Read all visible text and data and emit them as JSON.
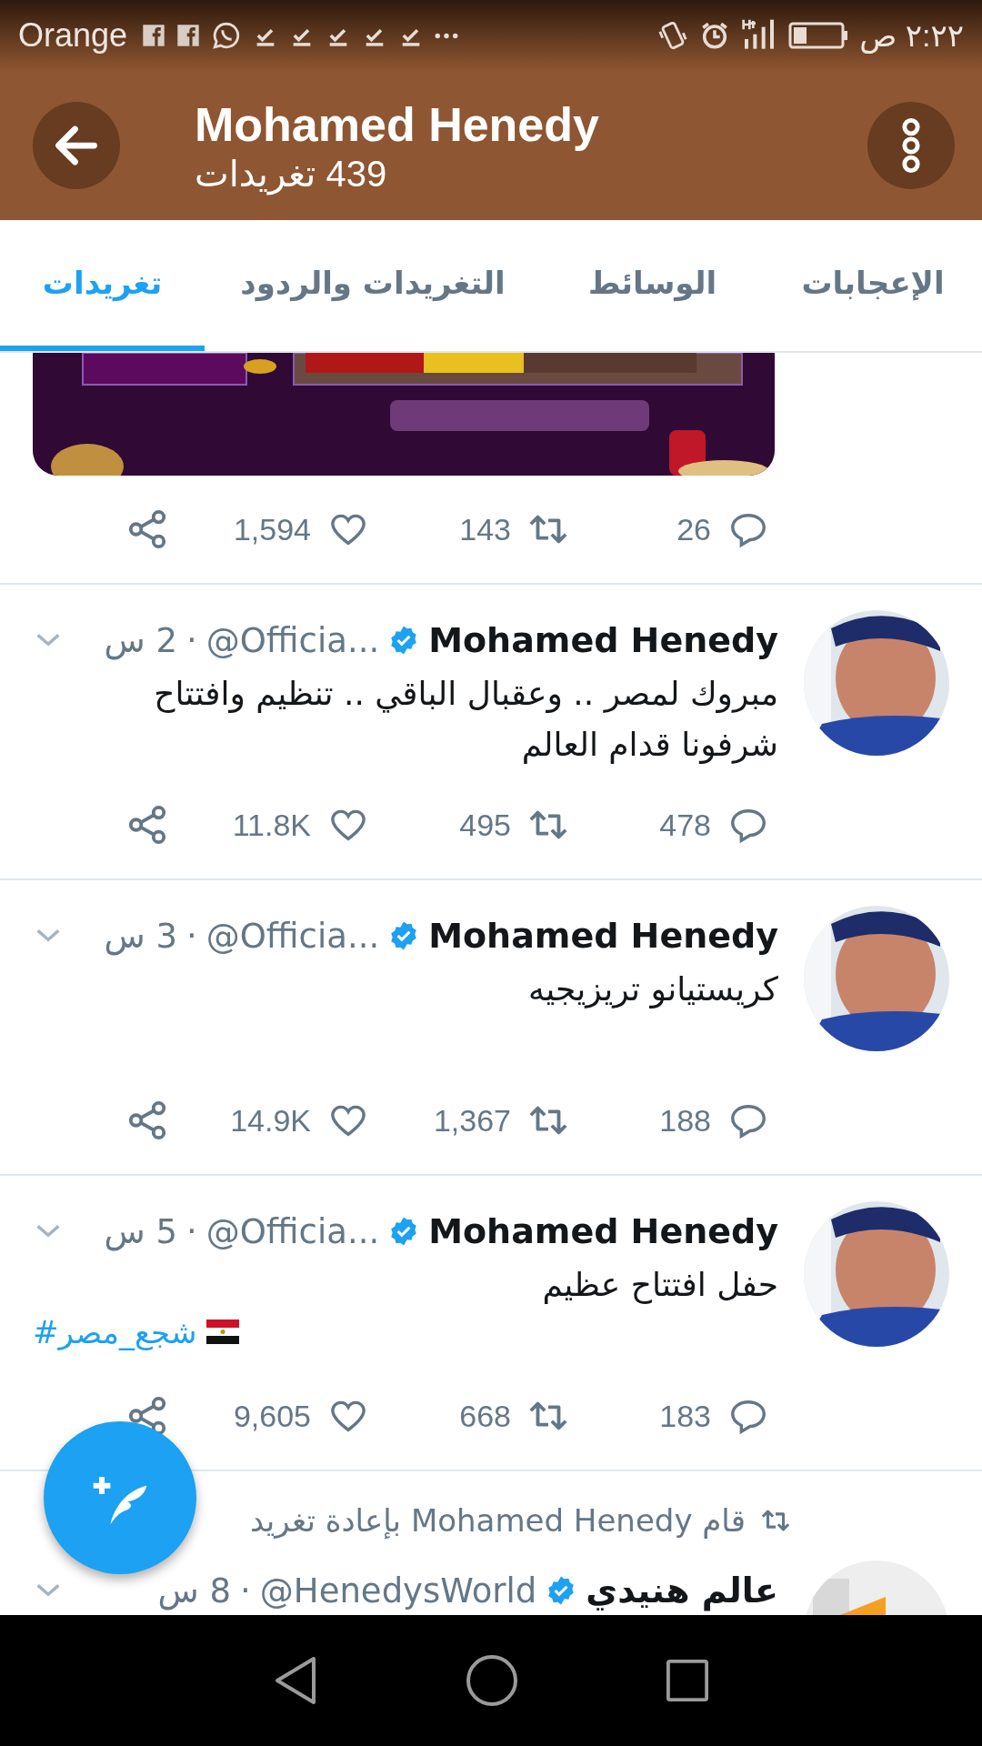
{
  "status_bar": {
    "carrier": "Orange",
    "time": "٢:٢٢ ص"
  },
  "header": {
    "title": "Mohamed Henedy",
    "subtitle": "439 تغريدات"
  },
  "tabs": [
    {
      "label": "الإعجابات",
      "selected": false
    },
    {
      "label": "الوسائط",
      "selected": false
    },
    {
      "label": "التغريدات والردود",
      "selected": false
    },
    {
      "label": "تغريدات",
      "selected": true
    }
  ],
  "feed": [
    {
      "kind": "media",
      "likes": "1,594",
      "retweets": "143",
      "replies": "26"
    },
    {
      "kind": "tweet",
      "name": "Mohamed Henedy",
      "verified": true,
      "handle": "@Officia...",
      "separator": "·",
      "time": "2 س",
      "text": "مبروك لمصر .. وعقبال الباقي .. تنظيم وافتتاح شرفونا قدام العالم",
      "likes": "11.8K",
      "retweets": "495",
      "replies": "478"
    },
    {
      "kind": "tweet",
      "name": "Mohamed Henedy",
      "verified": true,
      "handle": "@Officia...",
      "separator": "·",
      "time": "3 س",
      "text": "كريستيانو تريزيجيه",
      "likes": "14.9K",
      "retweets": "1,367",
      "replies": "188"
    },
    {
      "kind": "tweet",
      "name": "Mohamed Henedy",
      "verified": true,
      "handle": "@Officia...",
      "separator": "·",
      "time": "5 س",
      "text": "حفل افتتاح عظيم",
      "hashtag": "#شجع_مصر",
      "likes": "9,605",
      "retweets": "668",
      "replies": "183"
    },
    {
      "kind": "retweet",
      "retweeted_by": "قام Mohamed Henedy بإعادة تغريد",
      "name": "عالم هنيدي",
      "verified": true,
      "handle": "@HenedysWorld",
      "separator": "·",
      "time": "8 س"
    }
  ]
}
